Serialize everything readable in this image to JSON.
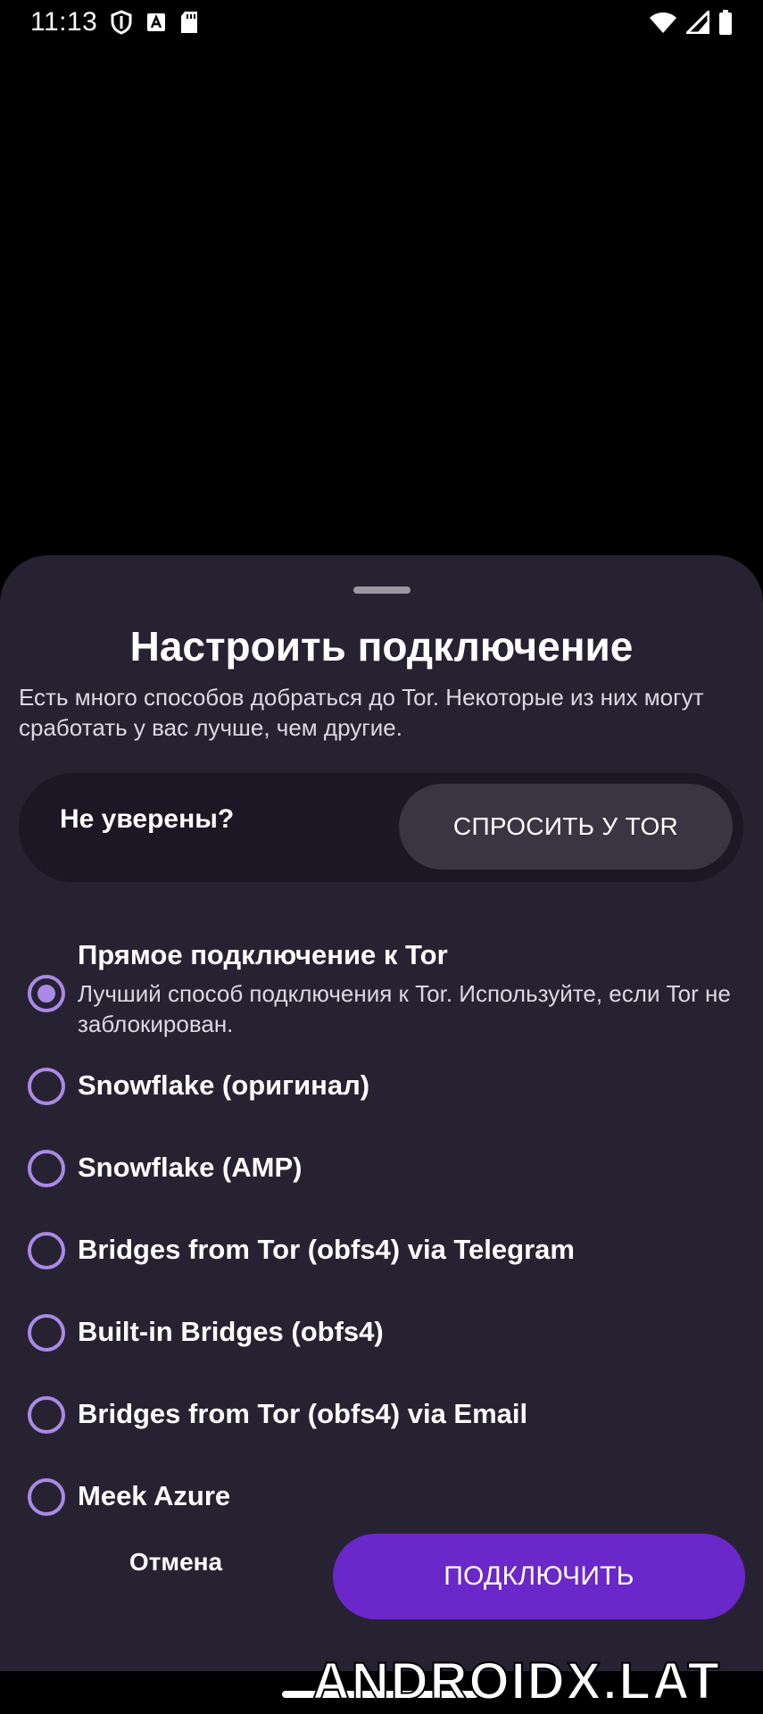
{
  "status_bar": {
    "time": "11:13",
    "icons": [
      "shield-icon",
      "a-badge-icon",
      "sd-card-icon",
      "wifi-icon",
      "signal-icon",
      "battery-icon"
    ]
  },
  "sheet": {
    "title": "Настроить подключение",
    "subtitle": "Есть много способов добраться до Tor. Некоторые из них могут сработать у вас лучше, чем другие.",
    "ask": {
      "label": "Не уверены?",
      "button": "СПРОСИТЬ У TOR"
    },
    "options": [
      {
        "label": "Прямое подключение к Tor",
        "description": "Лучший способ подключения к Tor. Используйте, если Tor не заблокирован.",
        "selected": true
      },
      {
        "label": "Snowflake (оригинал)",
        "selected": false
      },
      {
        "label": "Snowflake (AMP)",
        "selected": false
      },
      {
        "label": "Bridges from Tor (obfs4) via Telegram",
        "selected": false
      },
      {
        "label": "Built-in Bridges (obfs4)",
        "selected": false
      },
      {
        "label": "Bridges from Tor (obfs4) via Email",
        "selected": false
      },
      {
        "label": "Meek Azure",
        "selected": false
      }
    ],
    "cancel": "Отмена",
    "connect": "ПОДКЛЮЧИТЬ"
  },
  "watermark": "ANDROIDX.LAT",
  "colors": {
    "sheet_bg": "#272232",
    "accent": "#6a27c9",
    "radio": "#a98ae6"
  }
}
